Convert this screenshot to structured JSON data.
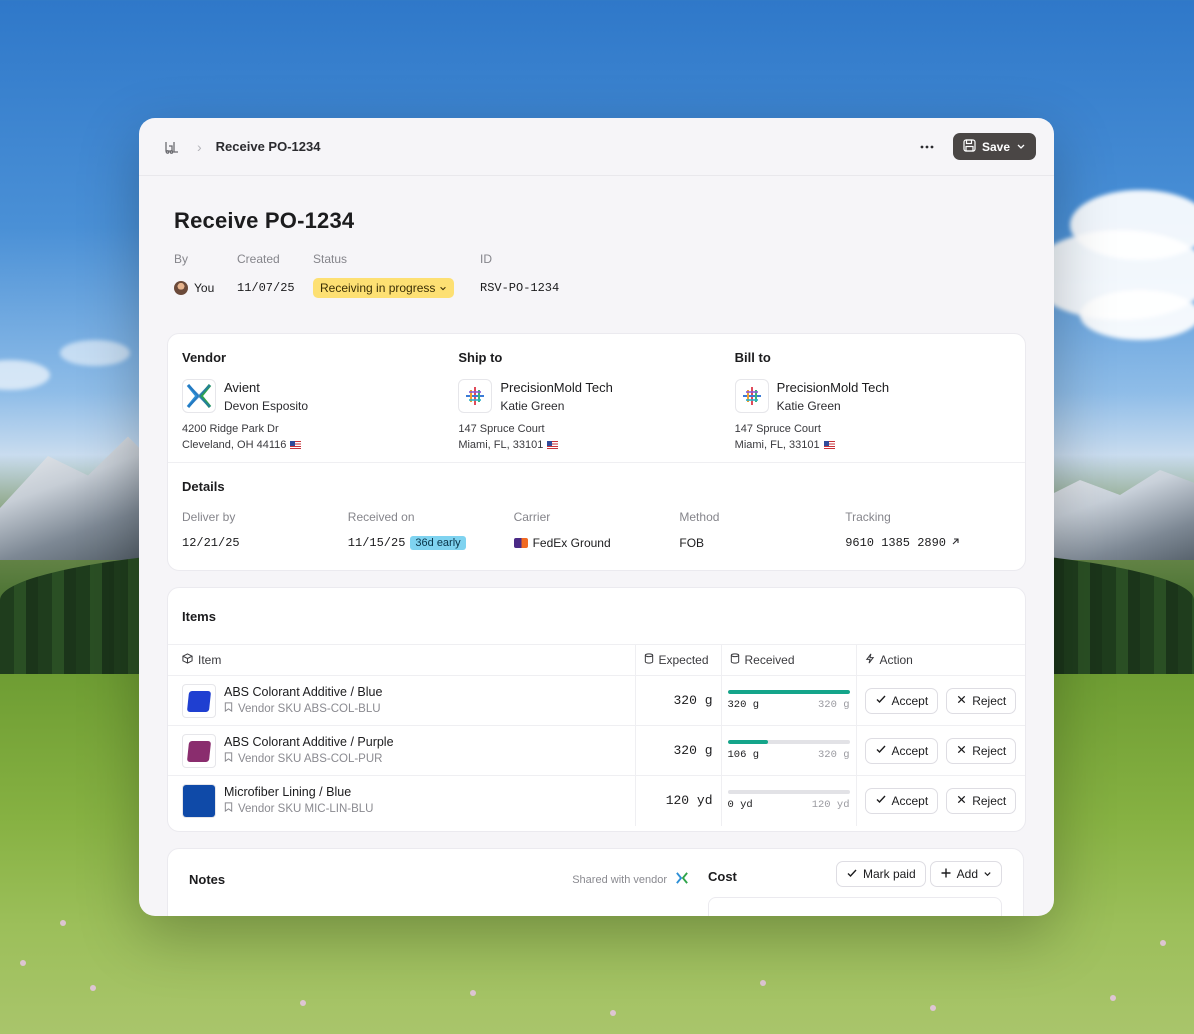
{
  "header": {
    "breadcrumb": "Receive PO-1234",
    "save_label": "Save"
  },
  "page": {
    "title": "Receive PO-1234",
    "meta": {
      "by_label": "By",
      "by_value": "You",
      "created_label": "Created",
      "created_value": "11/07/25",
      "status_label": "Status",
      "status_value": "Receiving in progress",
      "id_label": "ID",
      "id_value": "RSV-PO-1234"
    }
  },
  "addresses": {
    "vendor": {
      "heading": "Vendor",
      "company": "Avient",
      "contact": "Devon Esposito",
      "line1": "4200 Ridge Park Dr",
      "line2": "Cleveland, OH 44116"
    },
    "ship_to": {
      "heading": "Ship to",
      "company": "PrecisionMold Tech",
      "contact": "Katie Green",
      "line1": "147 Spruce Court",
      "line2": "Miami, FL, 33101"
    },
    "bill_to": {
      "heading": "Bill to",
      "company": "PrecisionMold Tech",
      "contact": "Katie Green",
      "line1": "147 Spruce Court",
      "line2": "Miami, FL, 33101"
    }
  },
  "details": {
    "heading": "Details",
    "deliver_by_label": "Deliver by",
    "deliver_by_value": "12/21/25",
    "received_on_label": "Received on",
    "received_on_value": "11/15/25",
    "early_badge": "36d early",
    "carrier_label": "Carrier",
    "carrier_value": "FedEx Ground",
    "method_label": "Method",
    "method_value": "FOB",
    "tracking_label": "Tracking",
    "tracking_value": "9610 1385 2890"
  },
  "items": {
    "heading": "Items",
    "columns": {
      "item": "Item",
      "expected": "Expected",
      "received": "Received",
      "action": "Action"
    },
    "accept_label": "Accept",
    "reject_label": "Reject",
    "rows": [
      {
        "name": "ABS Colorant Additive / Blue",
        "sku": "Vendor SKU ABS-COL-BLU",
        "expected": "320 g",
        "received": "320 g",
        "progress": 1.0,
        "thumb_color": "#1f3fd1"
      },
      {
        "name": "ABS Colorant Additive / Purple",
        "sku": "Vendor SKU ABS-COL-PUR",
        "expected": "320 g",
        "received": "106 g",
        "progress": 0.33,
        "thumb_color": "#8a2d6e"
      },
      {
        "name": "Microfiber Lining / Blue",
        "sku": "Vendor SKU MIC-LIN-BLU",
        "expected": "120 yd",
        "received": "0 yd",
        "progress": 0,
        "thumb_color": "#0f4aa8"
      }
    ]
  },
  "notes": {
    "heading": "Notes",
    "shared_label": "Shared with vendor"
  },
  "cost": {
    "heading": "Cost",
    "mark_paid_label": "Mark paid",
    "add_label": "Add"
  },
  "colors": {
    "accent_progress": "#15a58a",
    "status_yellow": "#fde073",
    "early_blue": "#7fd3f0",
    "save_button": "#4a4645"
  }
}
